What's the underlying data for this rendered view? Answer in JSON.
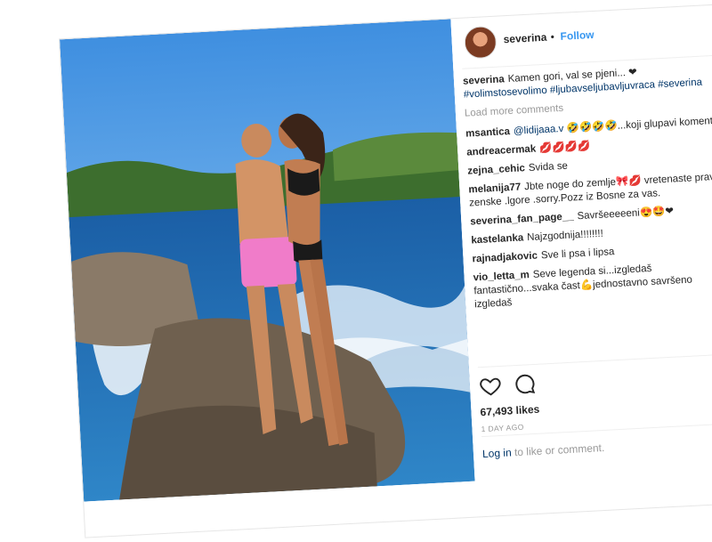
{
  "post": {
    "username": "severina",
    "dot": "•",
    "follow_label": "Follow",
    "caption_user": "severina",
    "caption_text": "Kamen gori, val se pjeni... ❤",
    "caption_tags": "#volimstosevolimo #ljubavseljubavljuvraca #severina",
    "load_more": "Load more comments",
    "likes": "67,493 likes",
    "age": "1 DAY AGO",
    "login_link": "Log in",
    "login_rest": " to like or comment."
  },
  "comments": [
    {
      "user": "msantica",
      "tag": "@lidijaaa.v",
      "text": " 🤣🤣🤣🤣...koji glupavi komentar"
    },
    {
      "user": "andreacermak",
      "tag": "",
      "text": "💋💋💋💋"
    },
    {
      "user": "zejna_cehic",
      "tag": "",
      "text": "Svida se"
    },
    {
      "user": "melanija77",
      "tag": "",
      "text": "Jbte noge do zemlje🎀💋 vretenaste prave zenske .lgore .sorry.Pozz iz Bosne za vas."
    },
    {
      "user": "severina_fan_page__",
      "tag": "",
      "text": "Savršeeeeeni😍🤩❤"
    },
    {
      "user": "kastelanka",
      "tag": "",
      "text": "Najzgodnija!!!!!!!!"
    },
    {
      "user": "rajnadjakovic",
      "tag": "",
      "text": "Sve li psa i lipsa"
    },
    {
      "user": "vio_letta_m",
      "tag": "",
      "text": "Seve legenda si...izgledaš fantastično...svaka čast💪jednostavno savršeno izgledaš"
    }
  ],
  "colors": {
    "link": "#3897f0",
    "tag": "#003569",
    "muted": "#999999"
  },
  "icons": [
    "heart-icon",
    "comment-icon"
  ]
}
